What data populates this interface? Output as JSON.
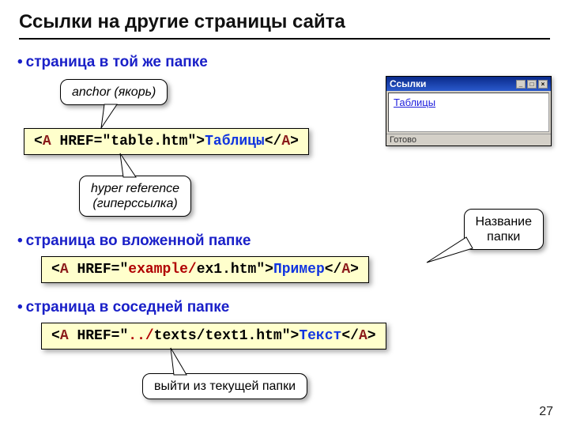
{
  "page": {
    "title": "Ссылки на другие страницы сайта",
    "number": "27"
  },
  "sections": {
    "same_folder": "страница в той же папке",
    "nested_folder": "страница во вложенной папке",
    "sibling_folder": "страница в соседней папке"
  },
  "callouts": {
    "anchor": "anchor (якорь)",
    "hyper_ref_1": "hyper reference",
    "hyper_ref_2": "(гиперссылка)",
    "folder_name_1": "Название",
    "folder_name_2": "папки",
    "go_up": "выйти из текущей папки"
  },
  "code1": {
    "lt1": "<",
    "a": "A",
    "sp": " ",
    "href": "HREF=",
    "q1": "\"",
    "file": "table.htm",
    "q2": "\"",
    "gt1": ">",
    "text": "Таблицы",
    "lt2": "</",
    "a2": "A",
    "gt2": ">"
  },
  "code2": {
    "lt1": "<",
    "a": "A",
    "sp": " ",
    "href": "HREF=",
    "q1": "\"",
    "folder": "example/",
    "file": "ex1.htm",
    "q2": "\"",
    "gt1": ">",
    "text": "Пример",
    "lt2": "</",
    "a2": "A",
    "gt2": ">"
  },
  "code3": {
    "lt1": "<",
    "a": "A",
    "sp": " ",
    "href": "HREF=",
    "q1": "\"",
    "up": "../",
    "folder": "texts/",
    "file": "text1.htm",
    "q2": "\"",
    "gt1": ">",
    "text": "Текст",
    "lt2": "</",
    "a2": "A",
    "gt2": ">"
  },
  "screenshot": {
    "title": "Ссылки",
    "link": "Таблицы",
    "status": "Готово"
  }
}
